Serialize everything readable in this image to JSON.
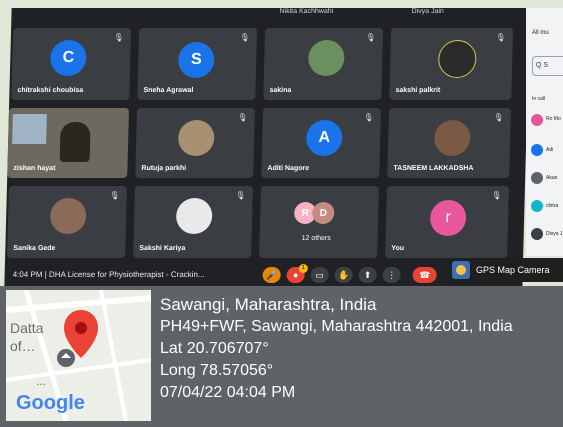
{
  "meet": {
    "top_names": [
      "Nikita Kachhwahi",
      "Divya Jain"
    ],
    "tiles": [
      {
        "name": "chitrakshi choubisa",
        "initial": "C",
        "color": "#1a73e8"
      },
      {
        "name": "Sneha Agrawal",
        "initial": "S",
        "color": "#1a73e8"
      },
      {
        "name": "sakina"
      },
      {
        "name": "sakshi palkrit"
      },
      {
        "name": "zishan hayat"
      },
      {
        "name": "Rutuja parkhi"
      },
      {
        "name": "Aditi Nagore",
        "initial": "A",
        "color": "#1a73e8"
      },
      {
        "name": "TASNEEM LAKKADSHA"
      },
      {
        "name": "Sanika Gede"
      },
      {
        "name": "Sakshi Kariya"
      },
      {
        "name": "12 others",
        "initials": [
          "R",
          "D"
        ]
      },
      {
        "name": "You",
        "initial": "r",
        "color": "#e8579b"
      }
    ],
    "toolbar": {
      "time": "4:04 PM",
      "meeting_title": "DHA License for Physiotherapist - Crackin...",
      "badge": "1"
    }
  },
  "side_panel": {
    "search_label": "Q S",
    "all_label": "All mu",
    "in_call_label": "In call",
    "people": [
      {
        "initial": "r",
        "label": "Ro Mo",
        "color": "#e8579b"
      },
      {
        "initial": "A",
        "label": "Adi",
        "color": "#1a73e8"
      },
      {
        "initial": "",
        "label": "Akan",
        "color": "#5f6368"
      },
      {
        "initial": "c",
        "label": "chitra",
        "color": "#12b5cb"
      },
      {
        "initial": "D",
        "label": "Divya J",
        "color": "#3c4043"
      }
    ]
  },
  "gps_badge": {
    "label": "GPS Map Camera"
  },
  "location": {
    "place": "Sawangi, Maharashtra, India",
    "address": "PH49+FWF, Sawangi, Maharashtra 442001, India",
    "lat": "Lat 20.706707°",
    "long": "Long 78.57056°",
    "datetime": "07/04/22 04:04 PM"
  },
  "map": {
    "label_top": "Datta",
    "label_of": "of…",
    "label_dots": "...",
    "brand": "Google"
  }
}
